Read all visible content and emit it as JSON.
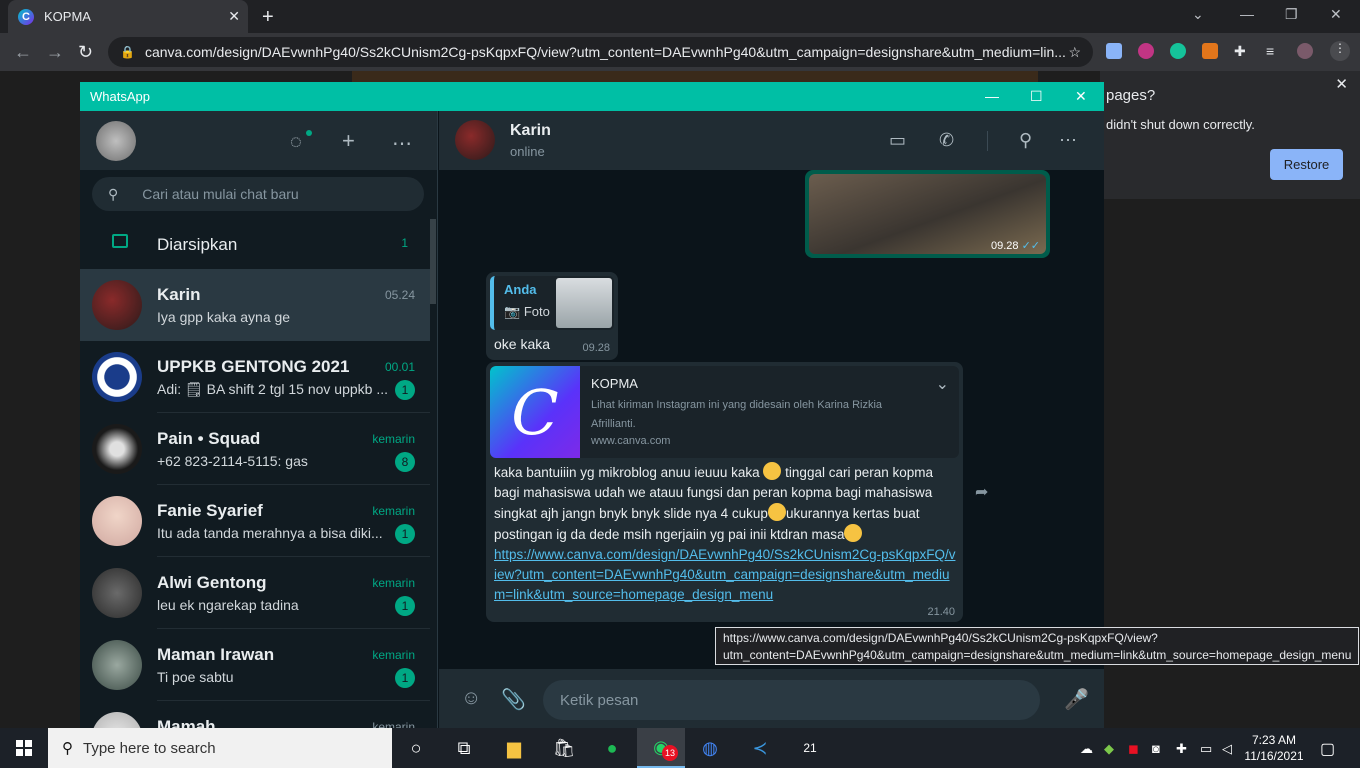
{
  "browser": {
    "tab_title": "KOPMA",
    "tab_favicon": "C",
    "url": "canva.com/design/DAEvwnhPg40/Ss2kCUnism2Cg-psKqpxFQ/view?utm_content=DAEvwnhPg40&utm_campaign=designshare&utm_medium=lin...",
    "restore_popup": {
      "title": "pages?",
      "message": "didn't shut down correctly.",
      "button": "Restore"
    }
  },
  "whatsapp": {
    "window_title": "WhatsApp",
    "search_placeholder": "Cari atau mulai chat baru",
    "archived": {
      "label": "Diarsipkan",
      "count": "1"
    },
    "chats": [
      {
        "name": "Karin",
        "time": "05.24",
        "preview": "Iya gpp kaka ayna ge",
        "badge": "",
        "active": true
      },
      {
        "name": "UPPKB GENTONG 2021",
        "time": "00.01",
        "preview": "Adi: 🗒 BA shift 2 tgl 15 nov uppkb ...",
        "badge": "1"
      },
      {
        "name": "Pain • Squad",
        "time": "kemarin",
        "preview": "+62 823-2114-5115: gas",
        "badge": "8"
      },
      {
        "name": "Fanie Syarief",
        "time": "kemarin",
        "preview": "Itu ada tanda merahnya a bisa diki...",
        "badge": "1"
      },
      {
        "name": "Alwi Gentong",
        "time": "kemarin",
        "preview": "leu ek ngarekap tadina",
        "badge": "1"
      },
      {
        "name": "Maman Irawan",
        "time": "kemarin",
        "preview": "Ti poe sabtu",
        "badge": "1"
      },
      {
        "name": "Mamah",
        "time": "kemarin",
        "preview": "",
        "badge": ""
      }
    ],
    "conversation": {
      "contact_name": "Karin",
      "status": "online",
      "photo_message_time": "09.28",
      "reply_message": {
        "quote_author": "Anda",
        "quote_type": "Foto",
        "text": "oke kaka",
        "time": "09.28"
      },
      "link_message": {
        "preview_title": "KOPMA",
        "preview_description": "Lihat kiriman Instagram ini yang didesain oleh Karina Rizkia Afrillianti.",
        "preview_domain": "www.canva.com",
        "text_part1": "kaka bantuiiin yg mikroblog  anuu ieuuu kaka ",
        "text_part2": " tinggal cari peran kopma bagi mahasiswa udah we atauu fungsi dan peran kopma bagi mahasiswa singkat ajh jangn bnyk bnyk slide nya 4 cukup",
        "text_part3": "ukurannya kertas buat postingan ig da dede msih ngerjaiin yg pai inii ktdran masa",
        "link": "https://www.canva.com/design/DAEvwnhPg40/Ss2kCUnism2Cg-psKqpxFQ/view?utm_content=DAEvwnhPg40&utm_campaign=designshare&utm_medium=link&utm_source=homepage_design_menu",
        "time": "21.40"
      },
      "composer_placeholder": "Ketik pesan"
    },
    "tooltip": "https://www.canva.com/design/DAEvwnhPg40/Ss2kCUnism2Cg-psKqpxFQ/view?\nutm_content=DAEvwnhPg40&utm_campaign=designshare&utm_medium=link&utm_source=homepage_design_menu"
  },
  "taskbar": {
    "search_placeholder": "Type here to search",
    "whatsapp_badge": "13",
    "clock_time": "7:23 AM",
    "clock_date": "11/16/2021",
    "calendar_day": "21"
  },
  "colors": {
    "accent": "#00a884",
    "titlebar": "#00bfa5",
    "link": "#53bdeb"
  }
}
